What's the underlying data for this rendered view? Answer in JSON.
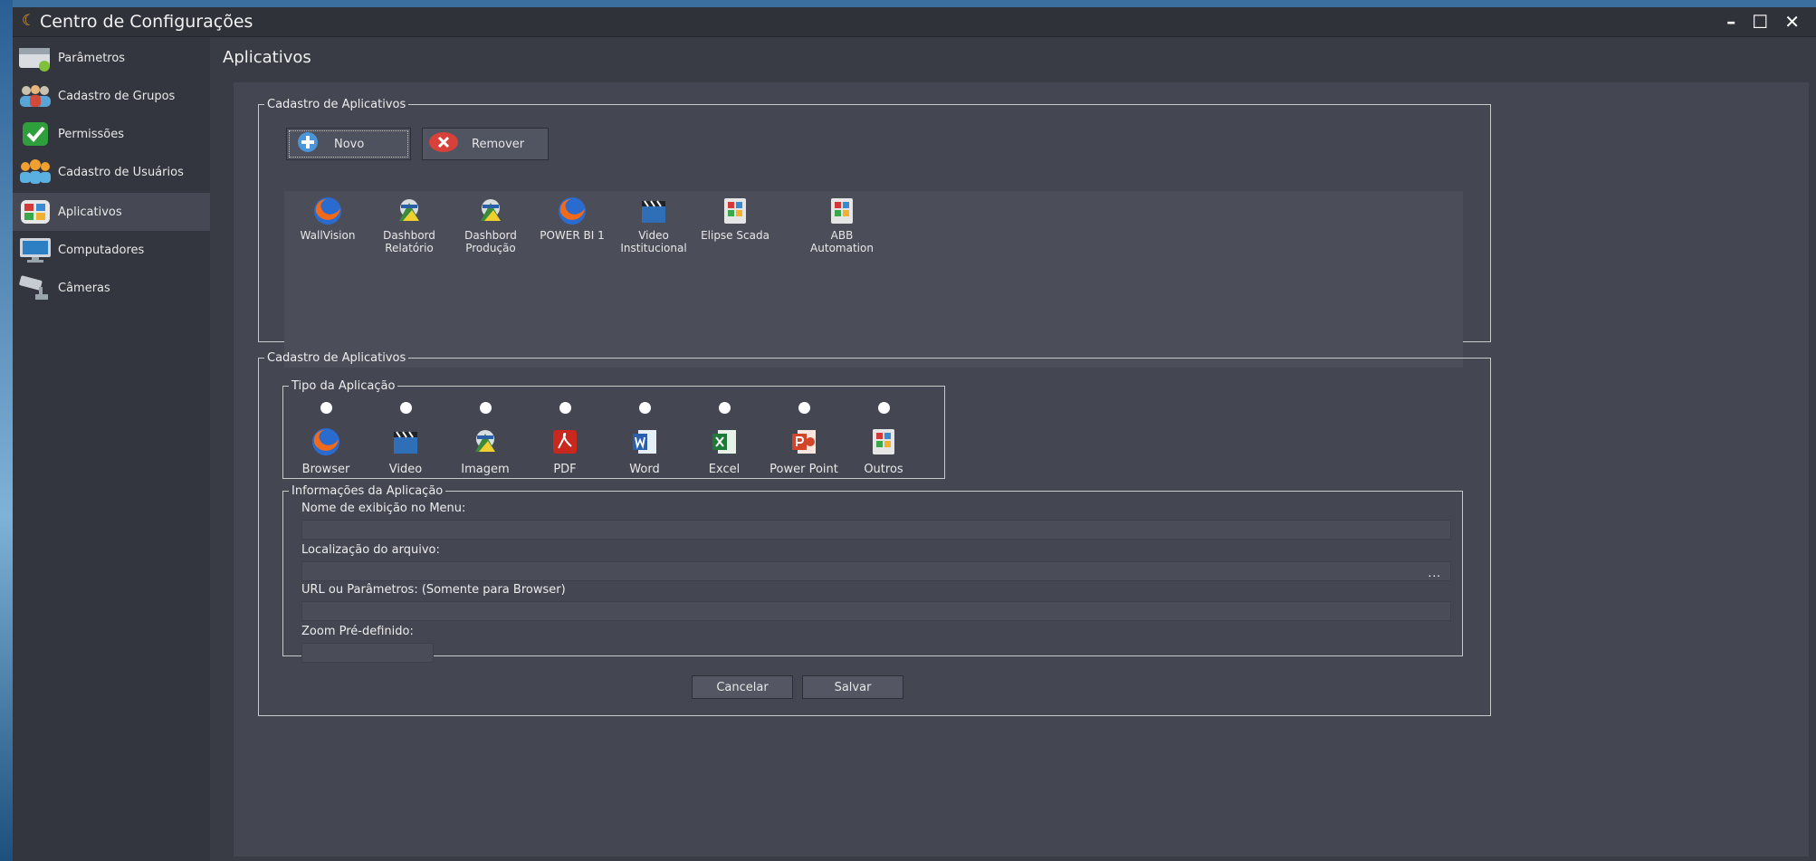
{
  "window": {
    "title": "Centro de Configurações",
    "logo": "☾",
    "min": "–",
    "max": "☐",
    "close": "✕"
  },
  "sidebar": {
    "items": [
      {
        "label": "Parâmetros",
        "icon": "parameters-icon"
      },
      {
        "label": "Cadastro de Grupos",
        "icon": "groups-icon"
      },
      {
        "label": "Permissões",
        "icon": "permissions-check-icon"
      },
      {
        "label": "Cadastro de Usuários",
        "icon": "users-icon"
      },
      {
        "label": "Aplicativos",
        "icon": "applications-icon",
        "active": true
      },
      {
        "label": "Computadores",
        "icon": "computer-monitor-icon"
      },
      {
        "label": "Câmeras",
        "icon": "security-camera-icon"
      }
    ]
  },
  "page": {
    "title": "Aplicativos"
  },
  "list_section": {
    "legend": "Cadastro de Aplicativos",
    "new_button": "Novo",
    "remove_button": "Remover",
    "apps": [
      {
        "label": "WallVision",
        "icon": "firefox-icon"
      },
      {
        "label": "Dashbord\nRelatório",
        "icon": "image-viewer-icon"
      },
      {
        "label": "Dashbord\nProdução",
        "icon": "image-viewer-icon"
      },
      {
        "label": "POWER BI 1",
        "icon": "firefox-icon"
      },
      {
        "label": "Video\nInstitucional",
        "icon": "video-clapper-icon"
      },
      {
        "label": "Elipse Scada",
        "icon": "generic-app-icon"
      },
      {
        "label": "ABB\nAutomation",
        "icon": "generic-app-icon"
      }
    ]
  },
  "form_section": {
    "legend": "Cadastro de Aplicativos",
    "type_legend": "Tipo da Aplicação",
    "types": [
      {
        "label": "Browser",
        "icon": "firefox-icon"
      },
      {
        "label": "Video",
        "icon": "video-clapper-icon"
      },
      {
        "label": "Imagem",
        "icon": "image-viewer-icon"
      },
      {
        "label": "PDF",
        "icon": "pdf-icon"
      },
      {
        "label": "Word",
        "icon": "word-icon"
      },
      {
        "label": "Excel",
        "icon": "excel-icon"
      },
      {
        "label": "Power Point",
        "icon": "powerpoint-icon"
      },
      {
        "label": "Outros",
        "icon": "generic-app-icon"
      }
    ],
    "info_legend": "Informações da Aplicação",
    "display_name_label": "Nome de exibição no Menu:",
    "display_name_value": "",
    "file_location_label": "Localização do arquivo:",
    "file_location_value": "",
    "browse_label": "...",
    "url_label": "URL ou Parâmetros: (Somente para Browser)",
    "url_value": "",
    "zoom_label": "Zoom Pré-definido:",
    "zoom_value": "",
    "cancel_button": "Cancelar",
    "save_button": "Salvar"
  },
  "colors": {
    "accent": "#f0a030",
    "background": "#3a3c45",
    "panel": "#444652"
  }
}
